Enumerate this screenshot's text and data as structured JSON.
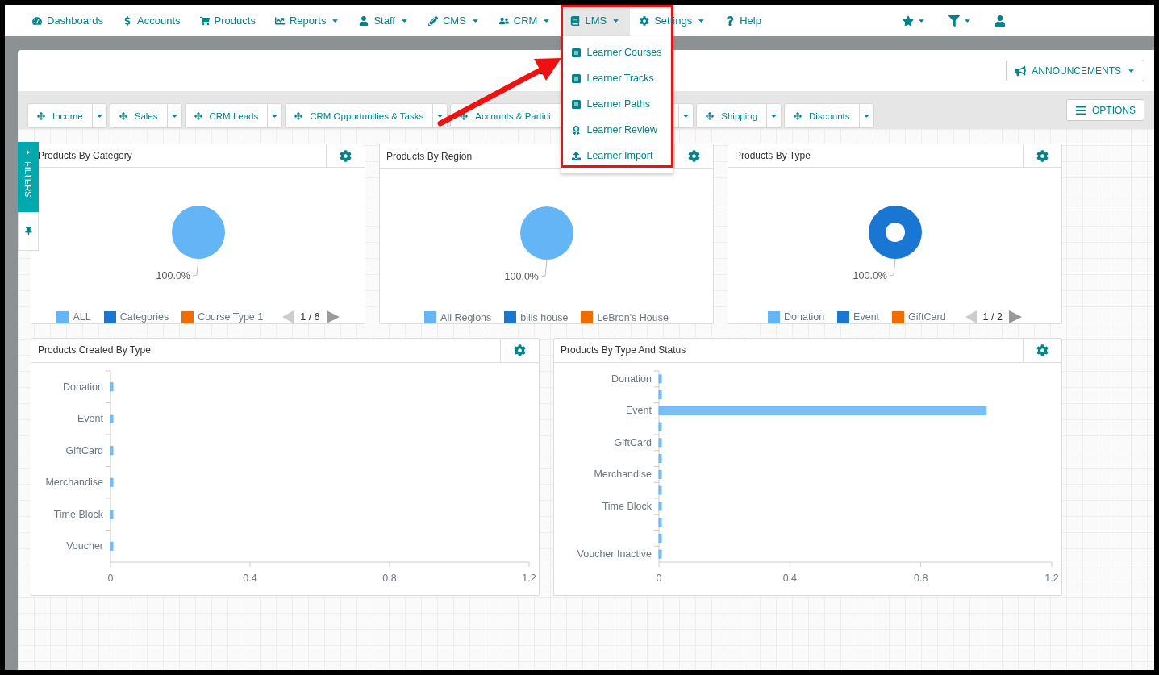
{
  "nav": {
    "items": [
      {
        "label": "Dashboards",
        "has_menu": false,
        "selected": false
      },
      {
        "label": "Accounts",
        "has_menu": false,
        "selected": false
      },
      {
        "label": "Products",
        "has_menu": false,
        "selected": false
      },
      {
        "label": "Reports",
        "has_menu": true,
        "selected": false
      },
      {
        "label": "Staff",
        "has_menu": true,
        "selected": false
      },
      {
        "label": "CMS",
        "has_menu": true,
        "selected": false
      },
      {
        "label": "CRM",
        "has_menu": true,
        "selected": false
      },
      {
        "label": "LMS",
        "has_menu": true,
        "selected": true,
        "menu": {
          "expanded": true,
          "items": [
            "Learner Courses",
            "Learner Tracks",
            "Learner Paths",
            "Learner Review",
            "Learner Import"
          ]
        }
      },
      {
        "label": "Settings",
        "has_menu": true,
        "selected": false
      },
      {
        "label": "Help",
        "has_menu": false,
        "selected": false
      }
    ],
    "right_items": [
      {
        "has_menu": true
      },
      {
        "has_menu": true
      },
      {
        "has_menu": false
      }
    ]
  },
  "dashboard": {
    "announcements_button": "ANNOUNCEMENTS",
    "options_button": "OPTIONS",
    "filters_tab": "FILTERS",
    "tabs": [
      "Income",
      "Sales",
      "CRM Leads",
      "CRM Opportunities & Tasks",
      "Accounts & Partici",
      "Shipping",
      "Discounts"
    ]
  },
  "widgets": [
    {
      "title": "Products By Category",
      "pager": "1 / 6",
      "chart_data": {
        "type": "pie",
        "categories": [
          "ALL",
          "Categories",
          "Course Type 1"
        ],
        "values": [
          1,
          0,
          0
        ],
        "colors": [
          "#64b5f6",
          "#1976d2",
          "#ef6c00"
        ],
        "value_labels": [
          "100.0%",
          null,
          null
        ]
      }
    },
    {
      "title": "Products By Region",
      "chart_data": {
        "type": "pie",
        "categories": [
          "All Regions",
          "bills house",
          "LeBron's House"
        ],
        "values": [
          1,
          0,
          0
        ],
        "colors": [
          "#64b5f6",
          "#1976d2",
          "#ef6c00"
        ],
        "value_labels": [
          "100.0%",
          null,
          null
        ]
      }
    },
    {
      "title": "Products By Type",
      "pager": "1 / 2",
      "chart_data": {
        "type": "donut",
        "categories": [
          "Donation",
          "Event",
          "GiftCard"
        ],
        "values": [
          0,
          1,
          0
        ],
        "colors": [
          "#64b5f6",
          "#1976d2",
          "#ef6c00"
        ],
        "value_labels": [
          null,
          "100.0%",
          null
        ]
      }
    },
    {
      "title": "Products Created By Type",
      "chart_data": {
        "type": "bar",
        "orientation": "horizontal",
        "categories": [
          "Donation",
          "Event",
          "GiftCard",
          "Merchandise",
          "Time Block",
          "Voucher"
        ],
        "series": [
          {
            "color": "#7dbff5",
            "values": [
              0,
              0,
              0,
              0,
              0,
              0
            ]
          }
        ],
        "xlim": [
          0,
          1.2
        ],
        "xticks": [
          0,
          0.4,
          0.8,
          1.2
        ]
      }
    },
    {
      "title": "Products By Type And Status",
      "chart_data": {
        "type": "bar",
        "orientation": "horizontal",
        "categories": [
          "Donation",
          null,
          "Event",
          null,
          "GiftCard",
          null,
          "Merchandise",
          null,
          "Time Block",
          null,
          null,
          "Voucher Inactive"
        ],
        "series": [
          {
            "color": "#7dbff5",
            "values": [
              0,
              0,
              1,
              0,
              0,
              0,
              0,
              0,
              0,
              0,
              0,
              0
            ]
          }
        ],
        "xlim": [
          0,
          1.2
        ],
        "xticks": [
          0,
          0.4,
          0.8,
          1.2
        ]
      }
    }
  ]
}
